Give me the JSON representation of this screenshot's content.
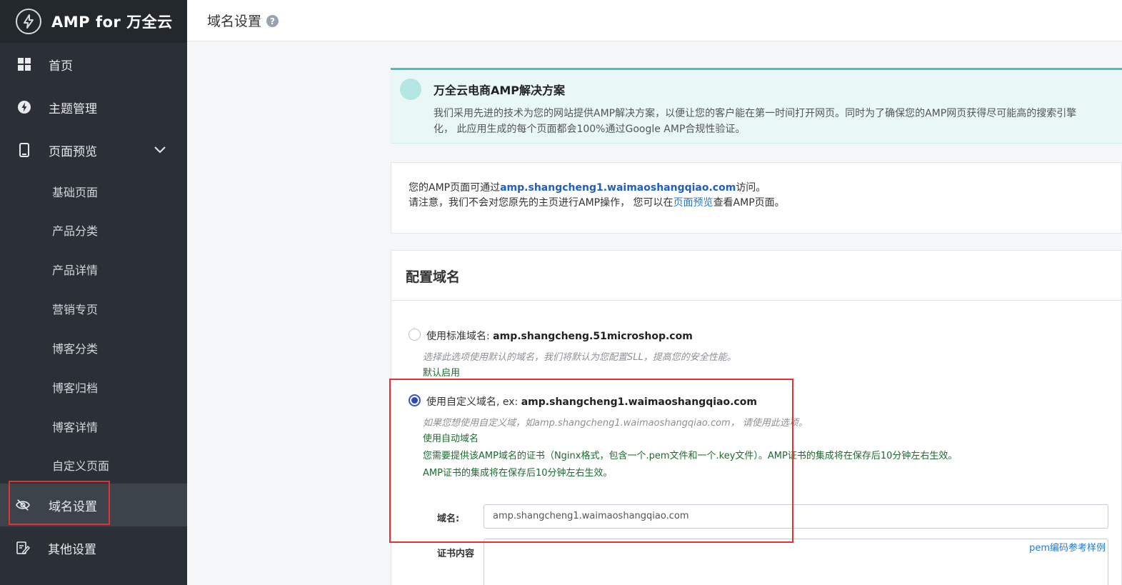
{
  "brand": {
    "title": "AMP for 万全云",
    "logo_icon": "lightning-circle-icon"
  },
  "sidebar": {
    "items": [
      {
        "label": "首页",
        "icon": "grid-icon"
      },
      {
        "label": "主题管理",
        "icon": "bolt-icon"
      },
      {
        "label": "页面预览",
        "icon": "mobile-icon"
      },
      {
        "label": "域名设置",
        "icon": "eye-slash-icon"
      },
      {
        "label": "其他设置",
        "icon": "edit-doc-icon"
      }
    ],
    "subitems": [
      {
        "label": "基础页面"
      },
      {
        "label": "产品分类"
      },
      {
        "label": "产品详情"
      },
      {
        "label": "营销专页"
      },
      {
        "label": "博客分类"
      },
      {
        "label": "博客归档"
      },
      {
        "label": "博客详情"
      },
      {
        "label": "自定义页面"
      }
    ]
  },
  "header": {
    "title": "域名设置",
    "help": "?"
  },
  "banner": {
    "title": "万全云电商AMP解决方案",
    "line1": "我们采用先进的技术为您的网站提供AMP解决方案，以便让您的客户能在第一时间打开网页。同时为了确保您的AMP网页获得尽可能高的搜索引擎",
    "line2": "化， 此应用生成的每个页面都会100%通过Google AMP合规性验证。"
  },
  "info": {
    "line1_prefix": "您的AMP页面可通过",
    "line1_link": "amp.shangcheng1.waimaoshangqiao.com",
    "line1_suffix": "访问。",
    "line2_prefix": "请注意，我们不会对您原先的主页进行AMP操作， 您可以在",
    "line2_link": "页面预览",
    "line2_suffix": "查看AMP页面。"
  },
  "config": {
    "title": "配置域名",
    "option1": {
      "label_prefix": "使用标准域名: ",
      "label_domain": "amp.shangcheng.51microshop.com",
      "hint": "选择此选项使用默认的域名，我们将默认为您配置SLL，提高您的安全性能。",
      "status": "默认启用"
    },
    "option2": {
      "label_prefix": "使用自定义域名, ex: ",
      "label_domain": "amp.shangcheng1.waimaoshangqiao.com",
      "hint": "如果您想使用自定义域，如amp.shangcheng1.waimaoshangqiao.com， 请使用此选项。",
      "status": "使用自动域名",
      "note1": "您需要提供该AMP域名的证书（Nginx格式，包含一个.pem文件和一个.key文件）。AMP证书的集成将在保存后10分钟左右生效。",
      "note2": "AMP证书的集成将在保存后10分钟左右生效。"
    },
    "domain_label": "域名:",
    "domain_value": "amp.shangcheng1.waimaoshangqiao.com",
    "cert_label": "证书内容",
    "pem_link": "pem编码参考样例"
  }
}
